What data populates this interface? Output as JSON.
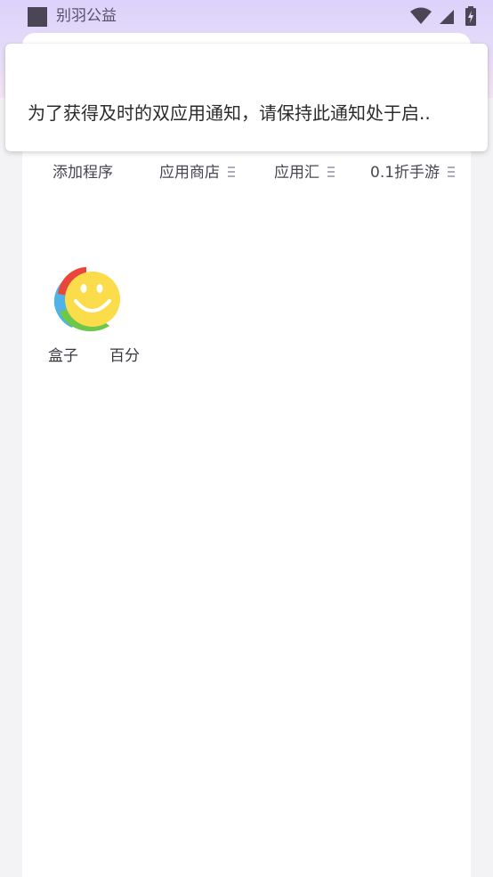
{
  "status_bar": {
    "app_name": "别羽公益",
    "icons": [
      "wifi-icon",
      "cellular-signal-icon",
      "battery-icon"
    ]
  },
  "notification": {
    "message": "为了获得及时的双应用通知，请保持此通知处于启.."
  },
  "tabs": [
    {
      "label": "添加程序",
      "has_handle": false
    },
    {
      "label": "应用商店",
      "has_handle": true
    },
    {
      "label": "应用汇",
      "has_handle": true
    },
    {
      "label": "0.1折手游",
      "has_handle": true
    }
  ],
  "apps": [
    {
      "label": "盒子",
      "icon": "smiley-face-app-icon"
    },
    {
      "label": "百分",
      "icon": ""
    }
  ],
  "colors": {
    "gradient_top": "#dcd2fb",
    "page_background": "#f3f3f5",
    "card": "#ffffff",
    "smiley_yellow": "#fbdc4a",
    "smiley_red": "#e9473b",
    "smiley_blue": "#4fb3e8",
    "smiley_green": "#6cc74a"
  }
}
